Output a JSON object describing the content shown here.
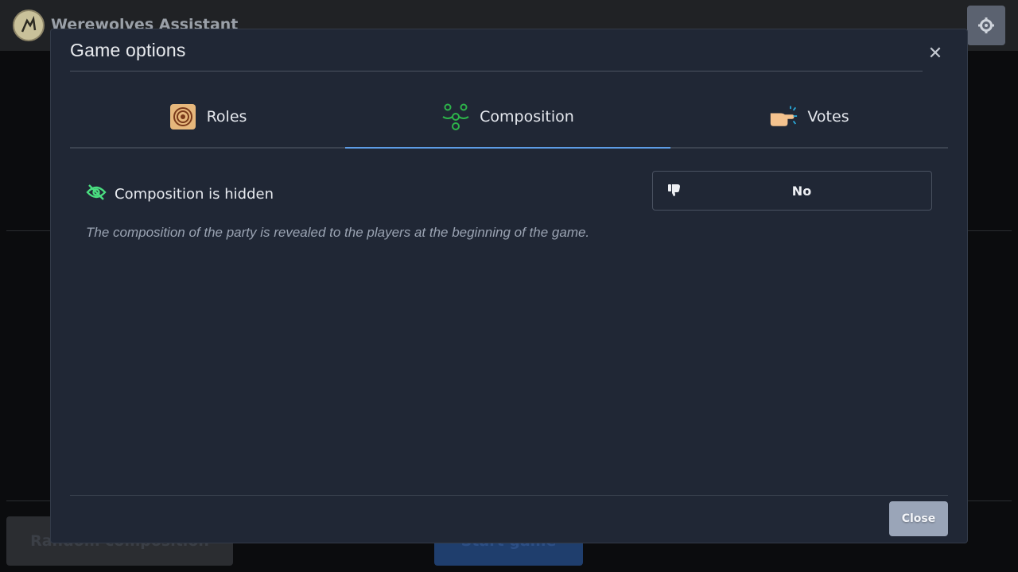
{
  "app": {
    "title": "Werewolves Assistant",
    "logo_icon": "werewolf-logo-icon",
    "settings_icon": "gear-icon"
  },
  "background": {
    "random_button_label": "Random composition",
    "start_button_label": "Start game"
  },
  "modal": {
    "title": "Game options",
    "close_icon": "close-icon",
    "tabs": [
      {
        "label": "Roles",
        "icon": "roles-icon",
        "active": false
      },
      {
        "label": "Composition",
        "icon": "composition-icon",
        "active": true
      },
      {
        "label": "Votes",
        "icon": "votes-icon",
        "active": false
      }
    ],
    "option": {
      "label": "Composition is hidden",
      "icon": "eye-slash-icon",
      "value": "No",
      "value_icon": "thumbs-down-icon",
      "description": "The composition of the party is revealed to the players at the beginning of the game."
    },
    "close_button_label": "Close"
  },
  "colors": {
    "accent": "#5d9ce6",
    "icon_green": "#4ade80",
    "modal_bg": "#202735"
  }
}
